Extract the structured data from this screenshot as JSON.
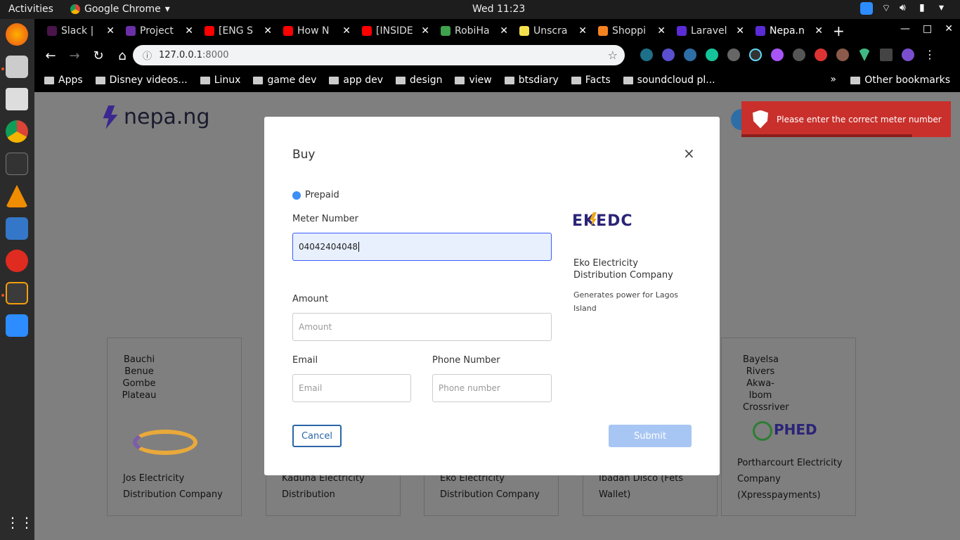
{
  "topbar": {
    "activities": "Activities",
    "app": "Google Chrome",
    "clock": "Wed 11:23"
  },
  "tabs": [
    {
      "title": "Slack |",
      "color": "#4a154b"
    },
    {
      "title": "Project",
      "color": "#6b2fa8"
    },
    {
      "title": "[ENG S",
      "color": "#ff0000"
    },
    {
      "title": "How N",
      "color": "#ff0000"
    },
    {
      "title": "[INSIDE",
      "color": "#ff0000"
    },
    {
      "title": "RobiHa",
      "color": "#3fa34d"
    },
    {
      "title": "Unscra",
      "color": "#f4e04d"
    },
    {
      "title": "Shoppi",
      "color": "#f58220"
    },
    {
      "title": "Laravel",
      "color": "#5b2bd6"
    },
    {
      "title": "Nepa.n",
      "color": "#5b2bd6"
    }
  ],
  "address": {
    "host": "127.0.0.1",
    "port": ":8000"
  },
  "bookmarks": [
    "Apps",
    "Disney videos...",
    "Linux",
    "game dev",
    "app dev",
    "design",
    "view",
    "btsdiary",
    "Facts",
    "soundcloud pl..."
  ],
  "other_bookmarks": "Other bookmarks",
  "site": {
    "logo_text": "nepa.ng"
  },
  "cards": [
    {
      "states": [
        "Bauchi",
        "Benue",
        "Gombe",
        "Plateau"
      ],
      "name": "Jos Electricity Distribution Company"
    },
    {
      "states": [],
      "name": "Kaduna Electricity Distribution"
    },
    {
      "states": [],
      "name": "Eko Electricity Distribution Company"
    },
    {
      "states": [],
      "name": "Ibadan Disco (Fets Wallet)"
    },
    {
      "states": [
        "Bayelsa",
        "Rivers",
        "Akwa-Ibom",
        "Crossriver"
      ],
      "name": "Portharcourt Electricity Company (Xpresspayments)",
      "logo": "PHED"
    }
  ],
  "modal": {
    "title": "Buy",
    "close": "×",
    "radio_label": "Prepaid",
    "meter_label": "Meter Number",
    "meter_value": "04042404048",
    "amount_label": "Amount",
    "amount_placeholder": "Amount",
    "email_label": "Email",
    "email_placeholder": "Email",
    "phone_label": "Phone Number",
    "phone_placeholder": "Phone number",
    "cancel": "Cancel",
    "submit": "Submit",
    "disco_logo": "EKEDC",
    "disco_name": "Eko Electricity Distribution Company",
    "disco_desc": "Generates power for Lagos Island"
  },
  "toast": {
    "message": "Please enter the correct meter number",
    "color": "#c9302c"
  }
}
